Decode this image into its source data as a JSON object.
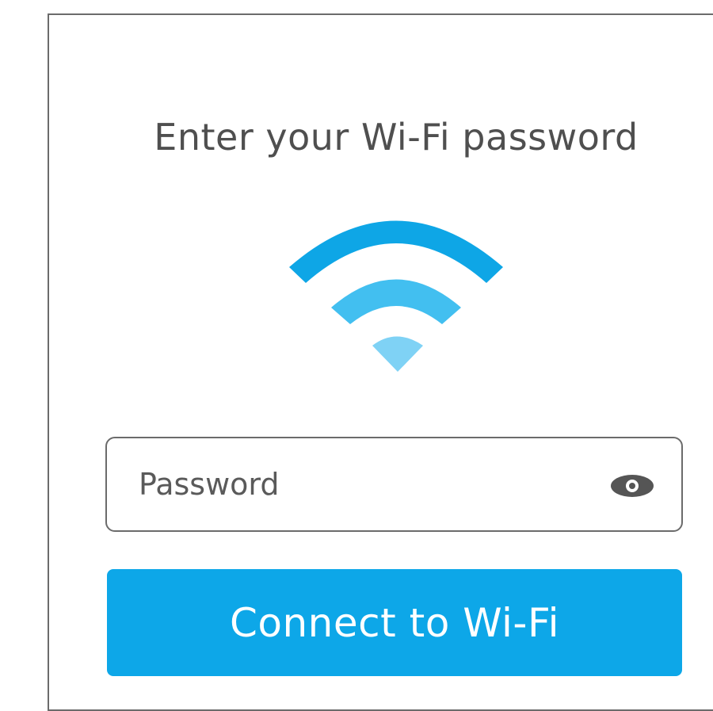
{
  "dialog": {
    "title": "Enter your Wi-Fi password"
  },
  "wifi_icon": {
    "name": "wifi-icon",
    "colors": {
      "outer_arc": "#0ea6e6",
      "middle_arc": "#42bff0",
      "dot": "#7fd2f5"
    }
  },
  "password_field": {
    "placeholder": "Password",
    "value": "",
    "toggle_icon": "eye-icon"
  },
  "connect_button": {
    "label": "Connect to Wi-Fi",
    "color": "#0da7e8"
  }
}
